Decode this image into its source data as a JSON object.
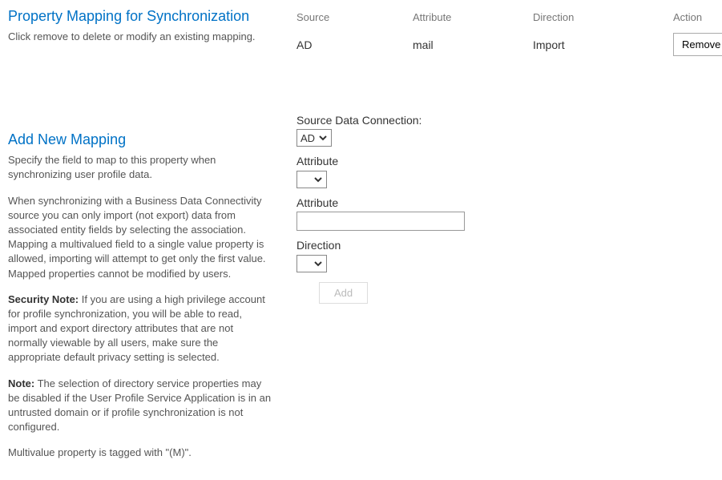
{
  "section1": {
    "title": "Property Mapping for Synchronization",
    "desc": "Click remove to delete or modify an existing mapping."
  },
  "table": {
    "headers": {
      "source": "Source",
      "attribute": "Attribute",
      "direction": "Direction",
      "action": "Action"
    },
    "row": {
      "source": "AD",
      "attribute": "mail",
      "direction": "Import",
      "remove": "Remove"
    }
  },
  "section2": {
    "title": "Add New Mapping",
    "desc1": "Specify the field to map to this property when synchronizing user profile data.",
    "desc2": "When synchronizing with a Business Data Connectivity source you can only import (not export) data from associated entity fields by selecting  the association. Mapping a multivalued field to a single value property is allowed, importing will attempt to get only the first value. Mapped properties cannot be modified by users.",
    "secLabel": "Security Note:",
    "secText": " If you are using a high privilege account for profile synchronization, you will be able to read, import and export directory attributes that are not normally viewable by all users, make sure the appropriate default privacy setting is selected.",
    "noteLabel": "Note:",
    "noteText": " The selection of directory service properties may be disabled if the User Profile Service Application is in an untrusted domain or if profile synchronization is not configured.",
    "multi": "Multivalue property is tagged with \"(M)\"."
  },
  "form": {
    "sourceLabel": "Source Data Connection:",
    "sourceValue": "AD",
    "attr1Label": "Attribute",
    "attr1Value": "",
    "attr2Label": "Attribute",
    "attr2Value": "",
    "dirLabel": "Direction",
    "dirValue": "",
    "addBtn": "Add"
  }
}
